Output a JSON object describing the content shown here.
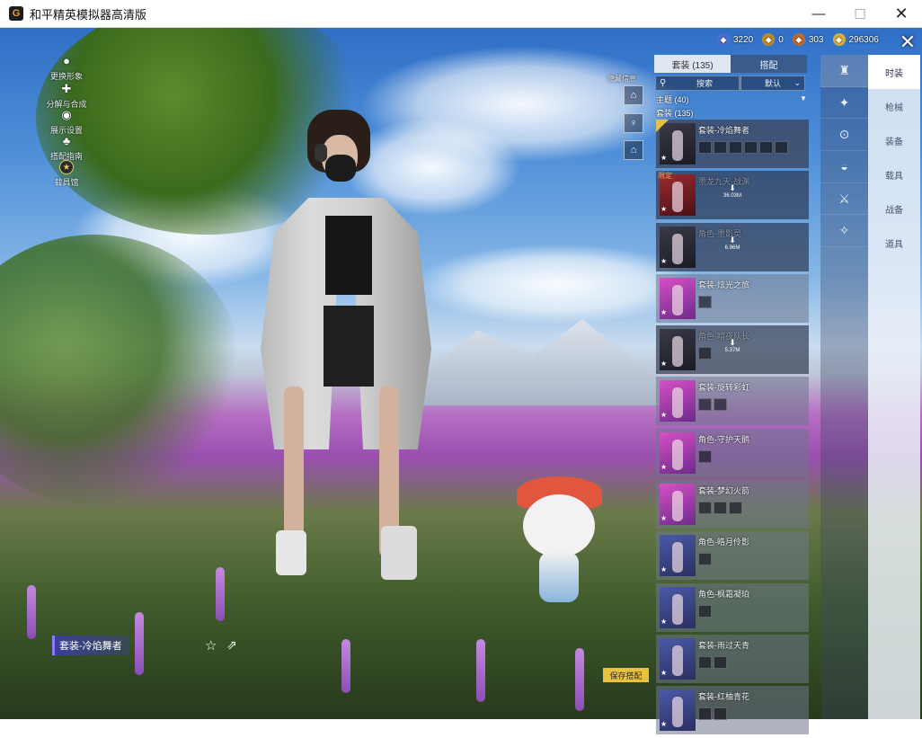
{
  "window": {
    "title": "和平精英模拟器高清版",
    "min_glyph": "—",
    "max_glyph": "☐",
    "close_glyph": "✕"
  },
  "left_menu": [
    {
      "label": "更换形象",
      "icon": "person-icon"
    },
    {
      "label": "分解与合成",
      "icon": "puzzle-icon"
    },
    {
      "label": "展示设置",
      "icon": "eye-icon"
    },
    {
      "label": "搭配指南",
      "icon": "hanger-icon"
    },
    {
      "label": "载具馆",
      "icon": "emblem-icon"
    }
  ],
  "currency": [
    {
      "value": "3220",
      "color": "#4a6fd8"
    },
    {
      "value": "0",
      "color": "#c08a2a"
    },
    {
      "value": "303",
      "color": "#c06a2a"
    },
    {
      "value": "296306",
      "color": "#d8b03a"
    }
  ],
  "tabs": {
    "suit": "套装 (135)",
    "match": "搭配"
  },
  "search": {
    "label": "搜索",
    "sort": "默认"
  },
  "list_labels": {
    "theme": "主题 (40)",
    "suit": "套装 (135)"
  },
  "stats_label": "隐藏信息",
  "outfits": [
    {
      "name": "套装-冷焰舞者",
      "thumb": "dark",
      "parts": 6,
      "selected": true
    },
    {
      "name": "墨龙九天·战渊",
      "thumb": "red",
      "parts": 0,
      "download": "36.03M",
      "limited": "限定"
    },
    {
      "name": "角色-墨影灵",
      "thumb": "dark",
      "parts": 0,
      "download": "6.96M"
    },
    {
      "name": "套装-炫光之旅",
      "thumb": "pink",
      "parts": 1
    },
    {
      "name": "角色-暗夜队长",
      "thumb": "dark",
      "parts": 1,
      "download": "5.37M"
    },
    {
      "name": "套装-旋转彩虹",
      "thumb": "pink",
      "parts": 2
    },
    {
      "name": "角色-守护天鹅",
      "thumb": "pink",
      "parts": 1
    },
    {
      "name": "套装-梦幻火箭",
      "thumb": "pink",
      "parts": 3
    },
    {
      "name": "角色-皓月伶影",
      "thumb": "blue",
      "parts": 1
    },
    {
      "name": "角色-枫霜凝珀",
      "thumb": "blue",
      "parts": 1
    },
    {
      "name": "套装-雨过天青",
      "thumb": "blue",
      "parts": 2
    },
    {
      "name": "套装-红柚青花",
      "thumb": "blue",
      "parts": 2
    }
  ],
  "categories": [
    {
      "label": "时装",
      "icon": "outfit-icon"
    },
    {
      "label": "枪械",
      "icon": "gun-icon"
    },
    {
      "label": "装备",
      "icon": "goggles-icon"
    },
    {
      "label": "载具",
      "icon": "helmet-icon"
    },
    {
      "label": "战备",
      "icon": "rifle-icon"
    },
    {
      "label": "道具",
      "icon": "pistol-icon"
    }
  ],
  "current_outfit": "套装-冷焰舞者",
  "save_label": "保存搭配"
}
